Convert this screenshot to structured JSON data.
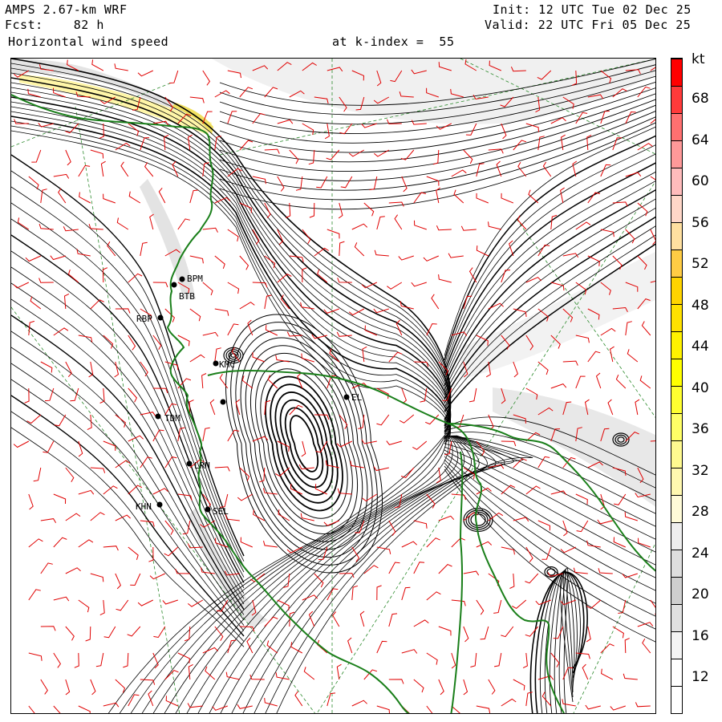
{
  "header": {
    "line1_left": "AMPS 2.67-km WRF",
    "line2_left": "Fcst:    82 h",
    "line3_left": "Horizontal wind speed",
    "line1_right": "Init: 12 UTC Tue 02 Dec 25",
    "line2_right": "Valid: 22 UTC Fri 05 Dec 25",
    "kindex": "at k-index =  55"
  },
  "colorbar": {
    "unit": "kt",
    "ticks": [
      "68",
      "64",
      "60",
      "56",
      "52",
      "48",
      "44",
      "40",
      "36",
      "32",
      "28",
      "24",
      "20",
      "16",
      "12"
    ],
    "colors": [
      "#ffffff",
      "#ffffff",
      "#f4f4f4",
      "#e0e0e0",
      "#cfcfcf",
      "#dedede",
      "#eeeeee",
      "#fffbd8",
      "#fff8b0",
      "#fffa90",
      "#ffff66",
      "#ffff30",
      "#ffff00",
      "#fff200",
      "#ffe100",
      "#ffd400",
      "#ffcc44",
      "#ffe0a0",
      "#ffd7c8",
      "#ffbcbc",
      "#ff9999",
      "#ff7070",
      "#ff3a3a",
      "#ff0000"
    ]
  },
  "stations": [
    {
      "id": "BPM",
      "label": "BPM"
    },
    {
      "id": "BTB",
      "label": "BTB"
    },
    {
      "id": "RBP",
      "label": "RBP"
    },
    {
      "id": "KMC",
      "label": "KMC"
    },
    {
      "id": "TDM",
      "label": "TDM"
    },
    {
      "id": "LRN",
      "label": "LRN"
    },
    {
      "id": "KHN",
      "label": "KHN"
    },
    {
      "id": "SEL",
      "label": "SEL"
    },
    {
      "id": "EL",
      "label": "EL"
    },
    {
      "id": "X1",
      "label": ""
    }
  ]
}
